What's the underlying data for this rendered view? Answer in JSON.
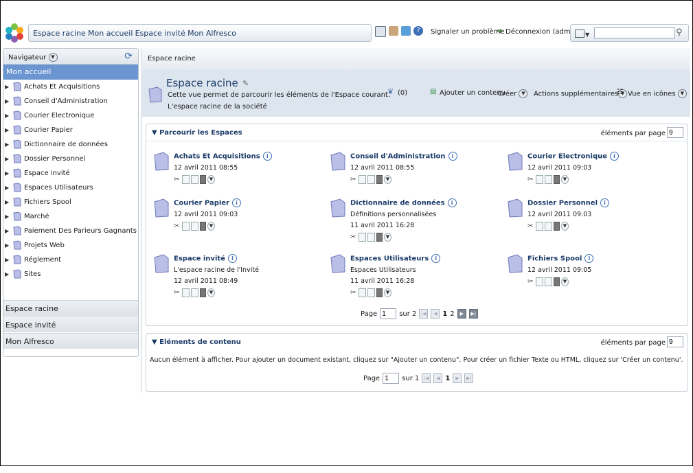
{
  "header": {
    "breadcrumbs": [
      "Espace racine",
      "Mon accueil",
      "Espace invité",
      "Mon Alfresco"
    ],
    "report_link": "Signaler un problème",
    "logout_link": "Déconnexion (admin)",
    "search_value": ""
  },
  "sidebar": {
    "title": "Navigateur",
    "active": "Mon accueil",
    "items": [
      {
        "label": "Achats Et Acquisitions"
      },
      {
        "label": "Conseil d'Administration"
      },
      {
        "label": "Courier Electronique"
      },
      {
        "label": "Courier Papier"
      },
      {
        "label": "Dictionnaire de données"
      },
      {
        "label": "Dossier Personnel"
      },
      {
        "label": "Espace invité"
      },
      {
        "label": "Espaces Utilisateurs"
      },
      {
        "label": "Fichiers Spool"
      },
      {
        "label": "Marché"
      },
      {
        "label": "Paiement Des Parieurs Gagnants"
      },
      {
        "label": "Projets Web"
      },
      {
        "label": "Réglement"
      },
      {
        "label": "Sites"
      }
    ],
    "sections": [
      "Espace racine",
      "Espace invité",
      "Mon Alfresco"
    ]
  },
  "main": {
    "breadcrumb": "Espace racine",
    "space_title": "Espace racine",
    "space_desc1": "Cette vue permet de parcourir les éléments de l'Espace courant.",
    "space_desc2": "L'espace racine de la société",
    "count": "(0)",
    "add_content": "Ajouter un contenu",
    "create": "Créer",
    "more_actions": "Actions supplémentaires",
    "view": "Vue en icônes"
  },
  "spaces_panel": {
    "title": "Parcourir les Espaces",
    "per_page_label": "éléments par page",
    "per_page_value": "9",
    "items": [
      {
        "name": "Achats Et Acquisitions",
        "desc": "",
        "date": "12 avril 2011 08:55"
      },
      {
        "name": "Conseil d'Administration",
        "desc": "",
        "date": "12 avril 2011 08:55"
      },
      {
        "name": "Courier Electronique",
        "desc": "",
        "date": "12 avril 2011 09:03"
      },
      {
        "name": "Courier Papier",
        "desc": "",
        "date": "12 avril 2011 09:03"
      },
      {
        "name": "Dictionnaire de données",
        "desc": "Définitions personnalisées",
        "date": "11 avril 2011 16:28"
      },
      {
        "name": "Dossier Personnel",
        "desc": "",
        "date": "12 avril 2011 09:03"
      },
      {
        "name": "Espace invité",
        "desc": "L'espace racine de l'Invité",
        "date": "12 avril 2011 08:49"
      },
      {
        "name": "Espaces Utilisateurs",
        "desc": "Espaces Utilisateurs",
        "date": "11 avril 2011 16:28"
      },
      {
        "name": "Fichiers Spool",
        "desc": "",
        "date": "12 avril 2011 09:05"
      }
    ],
    "pager": {
      "label": "Page",
      "value": "1",
      "of": "sur 2",
      "page1": "1",
      "page2": "2"
    }
  },
  "content_panel": {
    "title": "Eléments de contenu",
    "per_page_label": "éléments par page",
    "per_page_value": "9",
    "empty_text": "Aucun élément à afficher. Pour ajouter un document existant, cliquez sur \"Ajouter un contenu\". Pour créer un fichier Texte ou HTML, cliquez sur 'Créer un contenu'.",
    "pager": {
      "label": "Page",
      "value": "1",
      "of": "sur 1",
      "page1": "1"
    }
  },
  "colors": {
    "accent": "#6a95d0",
    "title": "#1c3c68",
    "panel_bg": "#dde5ef"
  }
}
